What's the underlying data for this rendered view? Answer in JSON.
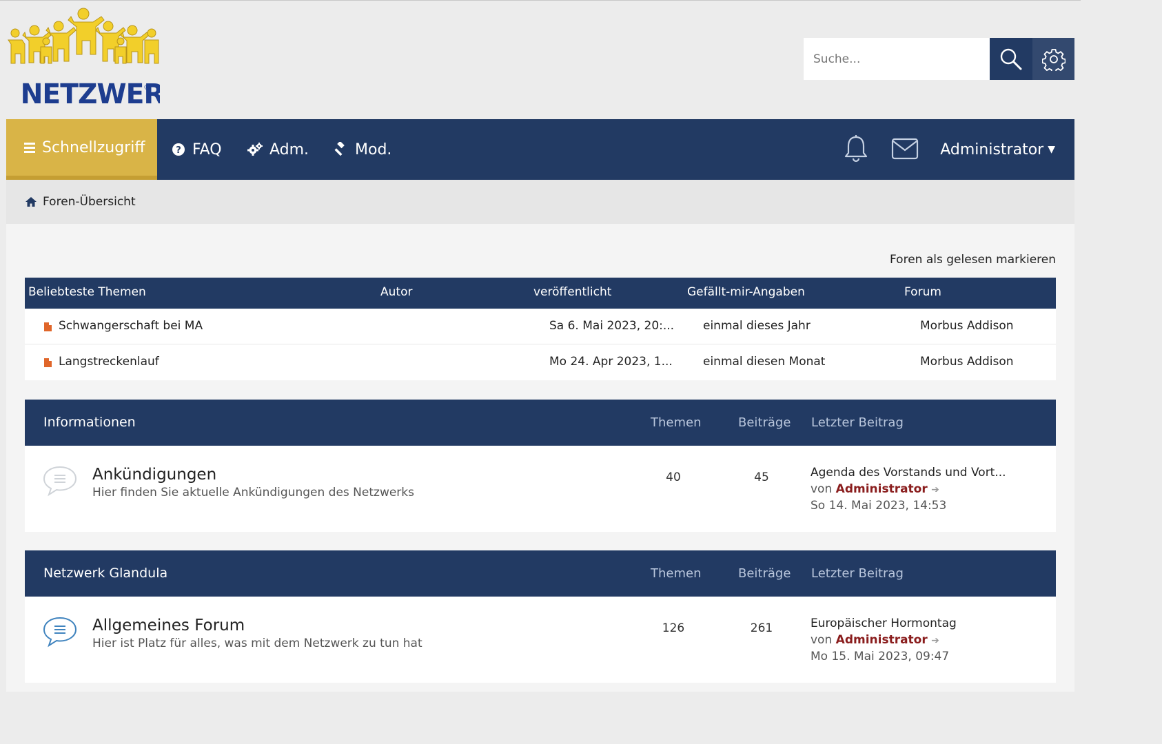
{
  "logo": {
    "text": "NETZWERK",
    "registered": "®"
  },
  "search": {
    "placeholder": "Suche...",
    "search_icon": "magnifier-icon",
    "advanced_icon": "gear-icon"
  },
  "navbar": {
    "quick_access": "Schnellzugriff",
    "items": [
      {
        "label": "FAQ",
        "icon": "question-circle-icon"
      },
      {
        "label": "Adm.",
        "icon": "gears-icon"
      },
      {
        "label": "Mod.",
        "icon": "gavel-icon"
      }
    ],
    "user": "Administrator",
    "colors": {
      "bar": "#223a63",
      "quick": "#d9b447"
    }
  },
  "breadcrumb": {
    "home": "Foren-Übersicht"
  },
  "mark_read": "Foren als gelesen markieren",
  "popular": {
    "headers": [
      "Beliebteste Themen",
      "Autor",
      "veröffentlicht",
      "Gefällt-mir-Angaben",
      "Forum"
    ],
    "rows": [
      {
        "topic": "Schwangerschaft bei MA",
        "author": "",
        "published": "Sa 6. Mai 2023, 20:...",
        "likes": "einmal dieses Jahr",
        "forum": "Morbus Addison"
      },
      {
        "topic": "Langstreckenlauf",
        "author": "",
        "published": "Mo 24. Apr 2023, 1...",
        "likes": "einmal diesen Monat",
        "forum": "Morbus Addison"
      }
    ]
  },
  "categories": [
    {
      "title": "Informationen",
      "col_topics": "Themen",
      "col_posts": "Beiträge",
      "col_last": "Letzter Beitrag",
      "forum": {
        "name": "Ankündigungen",
        "desc": "Hier finden Sie aktuelle Ankündigungen des Netzwerks",
        "topics": "40",
        "posts": "45",
        "last_title": "Agenda des Vorstands und Vort...",
        "last_by": "von",
        "last_user": "Administrator",
        "last_date": "So 14. Mai 2023, 14:53",
        "read": true
      }
    },
    {
      "title": "Netzwerk Glandula",
      "col_topics": "Themen",
      "col_posts": "Beiträge",
      "col_last": "Letzter Beitrag",
      "forum": {
        "name": "Allgemeines Forum",
        "desc": "Hier ist Platz für alles, was mit dem Netzwerk zu tun hat",
        "topics": "126",
        "posts": "261",
        "last_title": "Europäischer Hormontag",
        "last_by": "von",
        "last_user": "Administrator",
        "last_date": "Mo 15. Mai 2023, 09:47",
        "read": false
      }
    }
  ]
}
